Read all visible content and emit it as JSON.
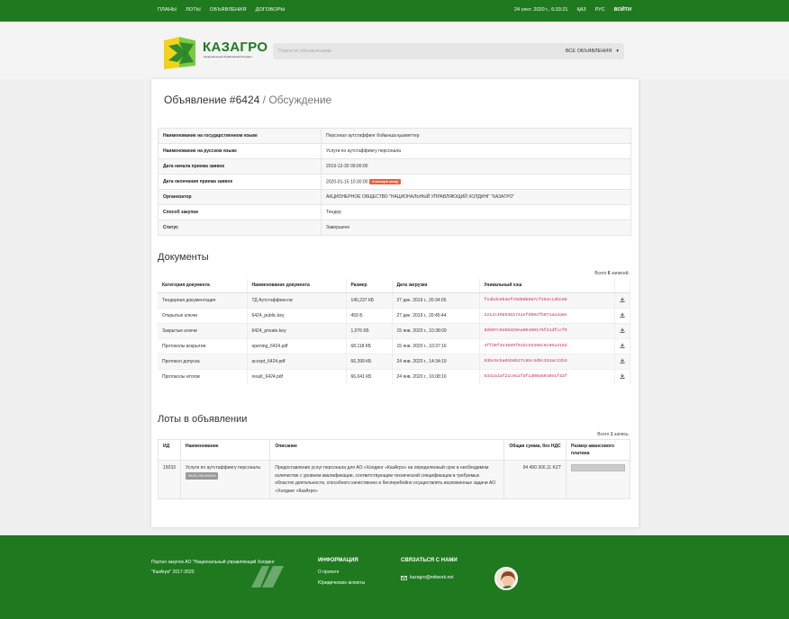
{
  "topnav": {
    "menu": [
      "ПЛАНЫ",
      "ЛОТЫ",
      "ОБЪЯВЛЕНИЯ",
      "ДОГОВОРЫ"
    ],
    "datetime": "24 сент. 2020 г., 6:33:21",
    "lang_kz": "ҚАЗ",
    "lang_ru": "РУС",
    "login": "ВОЙТИ"
  },
  "header": {
    "logo_text": "КАЗАГРО",
    "logo_sub": "Национальный Управляющий Холдинг",
    "search_placeholder": "Поиск по объявлениям",
    "scope_label": "ВСЕ ОБЪЯВЛЕНИЯ",
    "scope_caret": "▾"
  },
  "page": {
    "title": "Объявление #6424",
    "title_sep": " / ",
    "title_sub": "Обсуждение"
  },
  "info": [
    {
      "k": "Наименование на государственном языке",
      "v": "Персонал аутстаффинг бойынша қызметтер"
    },
    {
      "k": "Наименование на русском языке",
      "v": "Услуги по аутстаффингу персонала"
    },
    {
      "k": "Дата начала приема заявок",
      "v": "2019-12-30 09:00:00"
    },
    {
      "k": "Дата окончания приема заявок",
      "v": "2020-01-15 10:30:00",
      "badge": "8 месяцев назад"
    },
    {
      "k": "Организатор",
      "v": "АКЦИОНЕРНОЕ ОБЩЕСТВО \"НАЦИОНАЛЬНЫЙ УПРАВЛЯЮЩИЙ ХОЛДИНГ \"КАЗАГРО\""
    },
    {
      "k": "Способ закупки",
      "v": "Тендер"
    },
    {
      "k": "Статус",
      "v": "Завершено"
    }
  ],
  "documents": {
    "heading": "Документы",
    "total_prefix": "Всего",
    "total_count": "6",
    "total_suffix": "записей.",
    "headers": [
      "Категория документа",
      "Наименование документа",
      "Размер",
      "Дата загрузки",
      "Уникальный хэш"
    ],
    "rows": [
      {
        "cat": "Тендерная документация",
        "name": "ТД Аутстаффинг.rar",
        "size": "140,237 КБ",
        "date": "27 дек. 2019 г., 20:34:05",
        "hash": "f14bdc6b4ef79d60b687cf494c13bc88"
      },
      {
        "cat": "Открытые ключи",
        "name": "6424_public.key",
        "size": "459 Б",
        "date": "27 дек. 2019 г., 20:45:44",
        "hash": "2212c4985382741efd092fb071aa3a8e"
      },
      {
        "cat": "Закрытые ключи",
        "name": "6424_private.key",
        "size": "1,076 КБ",
        "date": "15 янв. 2020 г., 10:38:09",
        "hash": "82b07c946bd29ea05450176f21dfccf9"
      },
      {
        "cat": "Протоколы вскрытия",
        "name": "opening_6424.pdf",
        "size": "68,118 КБ",
        "date": "15 янв. 2020 г., 10:37:16",
        "hash": "4ffd6f4e3589f91bc55398c8c95a318d"
      },
      {
        "cat": "Протокол допуска",
        "name": "accept_6424.pdf",
        "size": "66,399 КБ",
        "date": "24 янв. 2020 г., 14:34:19",
        "hash": "53bc6cba01b8b27c85c4d5c334ac22b3"
      },
      {
        "cat": "Протоколы итогов",
        "name": "result_6424.pdf",
        "size": "66,041 КБ",
        "date": "24 янв. 2020 г., 16:08:16",
        "hash": "6342a1af21c0a1fdf1d00a5010e1f42f"
      }
    ]
  },
  "lots": {
    "heading": "Лоты в объявлении",
    "total_prefix": "Всего",
    "total_count": "1",
    "total_suffix": "запись.",
    "headers": [
      "ИД",
      "Наименование",
      "Описание",
      "Общая сумма, без НДС",
      "Размер авансового платежа"
    ],
    "rows": [
      {
        "id": "15033",
        "name": "Услуги по аутстаффингу персонала",
        "code": "781011.000.000004",
        "desc": "Предоставление услуг персонала для АО «Холдинг «КазАгро» на определенный срок в необходимом количестве с уровнем квалификации, соответствующем технической спецификации в требуемых областях деятельности, способного качественно и бесперебойно осуществлять возложенные задачи АО «Холдинг «КазАгро»",
        "sum": "94 490 300,11 KZT",
        "advance": ""
      }
    ]
  },
  "footer": {
    "portal_line1": "Портал закупок АО \"Национальный управляющий Холдинг",
    "portal_line2": "\"КазАгро\" 2017-2020",
    "info_heading": "ИНФОРМАЦИЯ",
    "info_links": [
      "О проекте",
      "Юридические аспекты"
    ],
    "contact_heading": "СВЯЗАТЬСЯ С НАМИ",
    "email": "kazagro@mitwork.net"
  },
  "colors": {
    "brand_green": "#1f7a1f",
    "badge": "#e8603c",
    "hash": "#c7254e"
  }
}
